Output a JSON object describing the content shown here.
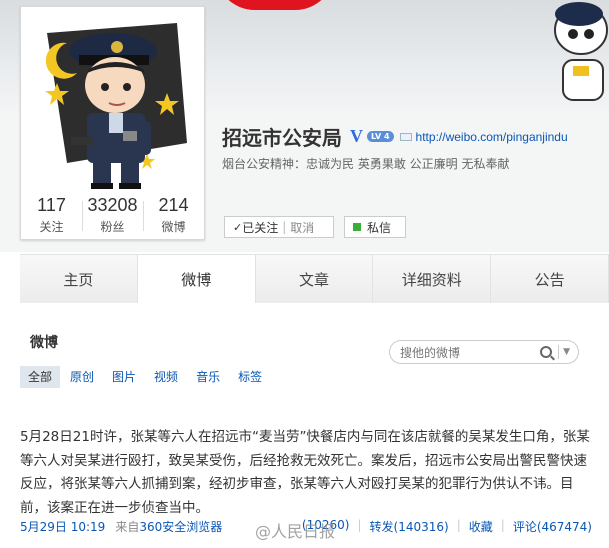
{
  "profile": {
    "name": "招远市公安局",
    "verified_mark": "V",
    "level": "LV 4",
    "url": "http://weibo.com/pinganjindu",
    "motto": "烟台公安精神：忠诚为民 英勇果敢 公正廉明 无私奉献",
    "stats": [
      {
        "num": "117",
        "label": "关注"
      },
      {
        "num": "33208",
        "label": "粉丝"
      },
      {
        "num": "214",
        "label": "微博"
      }
    ],
    "follow_button": {
      "check": "✓",
      "label": "已关注",
      "sep": "|",
      "cancel": "取消"
    },
    "message_button": "私信"
  },
  "tabs": [
    "主页",
    "微博",
    "文章",
    "详细资料",
    "公告"
  ],
  "active_tab": 1,
  "main": {
    "section_title": "微博",
    "search_placeholder": "搜他的微博",
    "filters": [
      "全部",
      "原创",
      "图片",
      "视频",
      "音乐",
      "标签"
    ]
  },
  "post": {
    "text": "5月28日21时许，张某等六人在招远市“麦当劳”快餐店内与同在该店就餐的吴某发生口角，张某等六人对吴某进行殴打，致吴某受伤，后经抢救无效死亡。案发后，招远市公安局出警民警快速反应，将张某等六人抓捕到案，经初步审查，张某等六人对殴打吴某的犯罪行为供认不讳。目前，该案正在进一步侦查当中。",
    "time": "5月29日 10:19",
    "source_prefix": "来自",
    "source": "360安全浏览器",
    "like": "(10260)",
    "repost": "转发(140316)",
    "favorite": "收藏",
    "comment": "评论(467474)"
  },
  "watermark": "@人民日报",
  "colors": {
    "link": "#0a57b4",
    "verified": "#2b6de0",
    "banner_red": "#e0141e"
  }
}
